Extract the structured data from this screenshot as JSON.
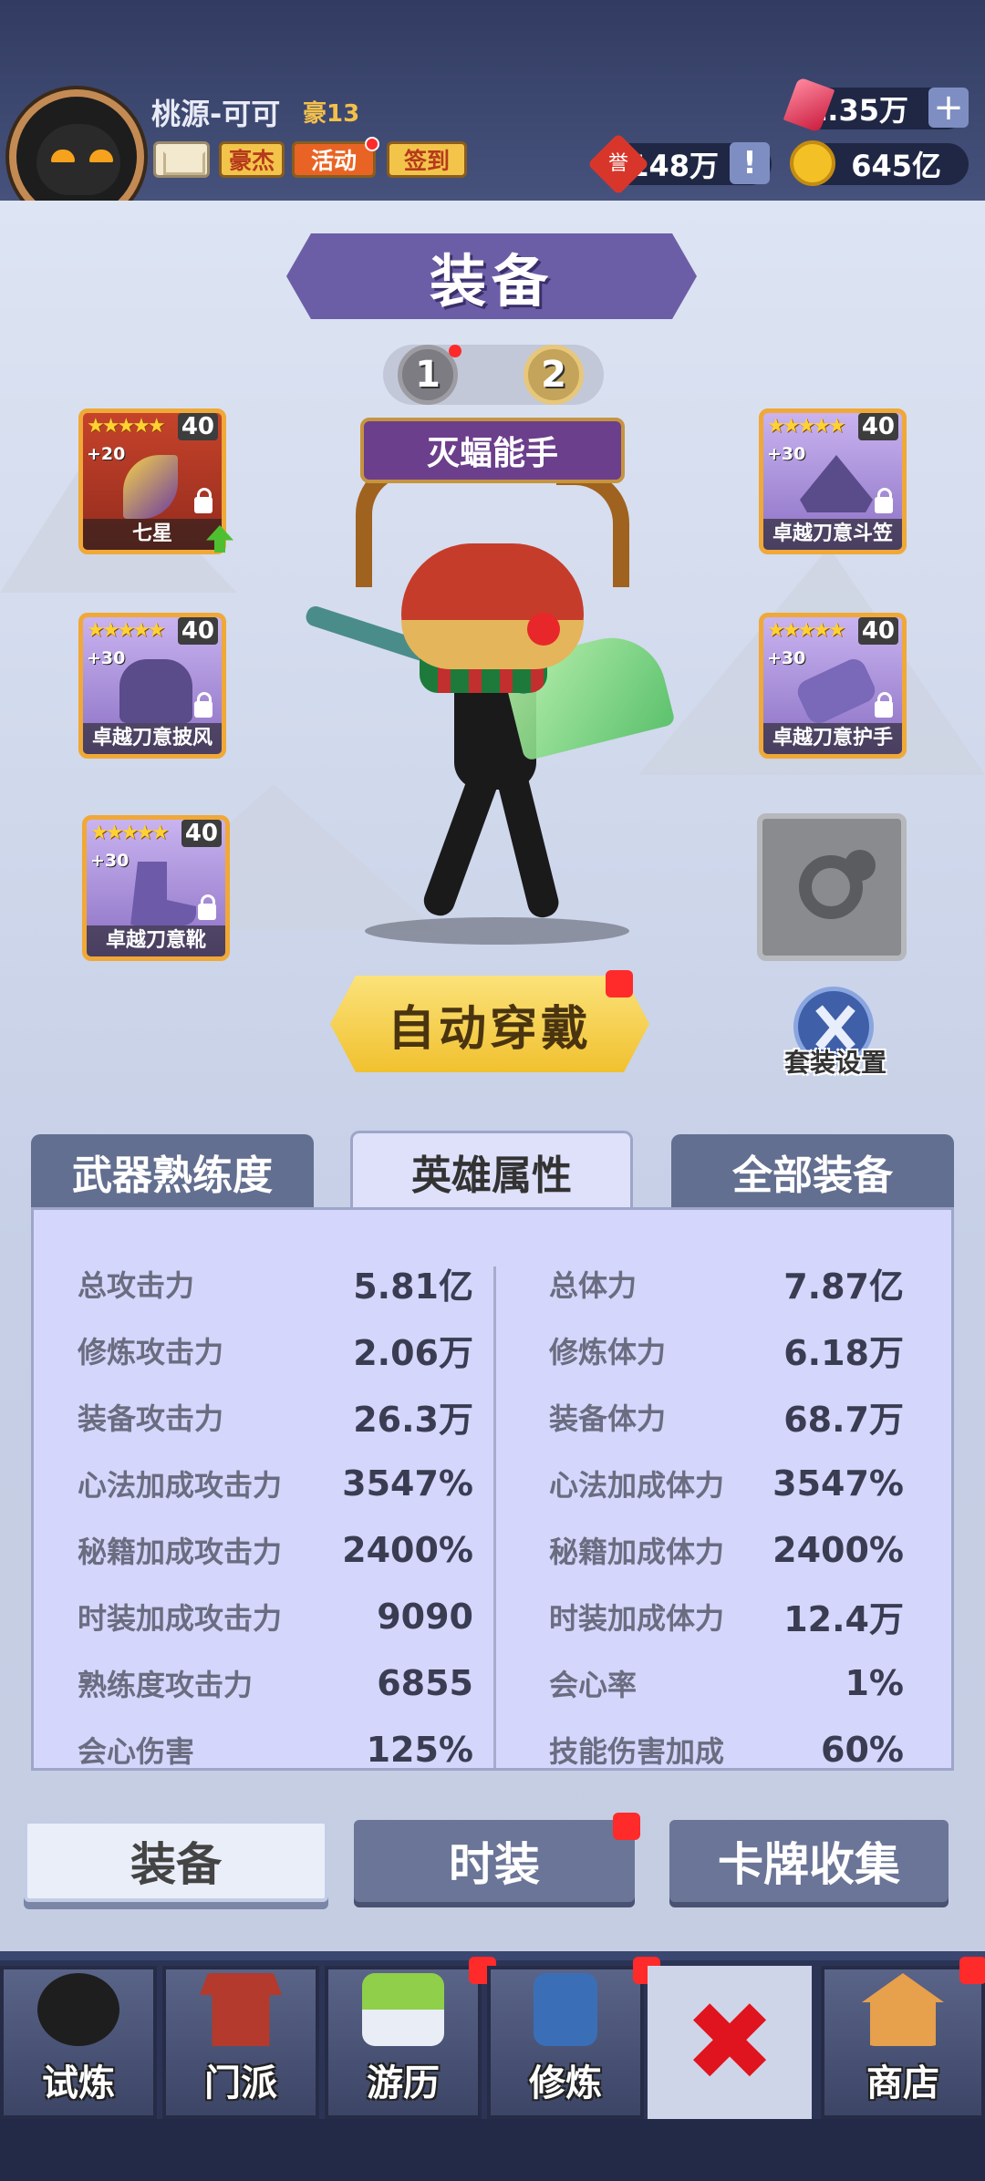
{
  "header": {
    "player_name": "桃源-可可",
    "vip_label": "豪13",
    "buttons": {
      "hero": "豪杰",
      "activity": "活动",
      "signin": "签到"
    },
    "resources": {
      "gems": "1.35万",
      "honor": "148万",
      "gold": "645亿",
      "honor_icon": "誉"
    }
  },
  "panel": {
    "title": "装备",
    "pages": [
      "1",
      "2"
    ],
    "hero_title": "灭蝠能手",
    "slots": [
      {
        "stars": "★★★★★",
        "level": "40",
        "plus": "+20",
        "name": "七星"
      },
      {
        "stars": "★★★★★",
        "level": "40",
        "plus": "+30",
        "name": "卓越刀意斗笠"
      },
      {
        "stars": "★★★★★",
        "level": "40",
        "plus": "+30",
        "name": "卓越刀意披风"
      },
      {
        "stars": "★★★★★",
        "level": "40",
        "plus": "+30",
        "name": "卓越刀意护手"
      },
      {
        "stars": "★★★★★",
        "level": "40",
        "plus": "+30",
        "name": "卓越刀意靴"
      }
    ],
    "auto_equip": "自动穿戴",
    "suit_settings": "套装设置"
  },
  "stats": {
    "tabs": [
      "武器熟练度",
      "英雄属性",
      "全部装备"
    ],
    "left": [
      {
        "label": "总攻击力",
        "value": "5.81亿"
      },
      {
        "label": "修炼攻击力",
        "value": "2.06万"
      },
      {
        "label": "装备攻击力",
        "value": "26.3万"
      },
      {
        "label": "心法加成攻击力",
        "value": "3547%"
      },
      {
        "label": "秘籍加成攻击力",
        "value": "2400%"
      },
      {
        "label": "时装加成攻击力",
        "value": "9090"
      },
      {
        "label": "熟练度攻击力",
        "value": "6855"
      },
      {
        "label": "会心伤害",
        "value": "125%"
      }
    ],
    "right": [
      {
        "label": "总体力",
        "value": "7.87亿"
      },
      {
        "label": "修炼体力",
        "value": "6.18万"
      },
      {
        "label": "装备体力",
        "value": "68.7万"
      },
      {
        "label": "心法加成体力",
        "value": "3547%"
      },
      {
        "label": "秘籍加成体力",
        "value": "2400%"
      },
      {
        "label": "时装加成体力",
        "value": "12.4万"
      },
      {
        "label": "会心率",
        "value": "1%"
      },
      {
        "label": "技能伤害加成",
        "value": "60%"
      }
    ]
  },
  "bottom_tabs": [
    "装备",
    "时装",
    "卡牌收集"
  ],
  "nav": {
    "items": [
      "试炼",
      "门派",
      "游历",
      "修炼",
      "商店"
    ],
    "close_symbol": "✖"
  }
}
